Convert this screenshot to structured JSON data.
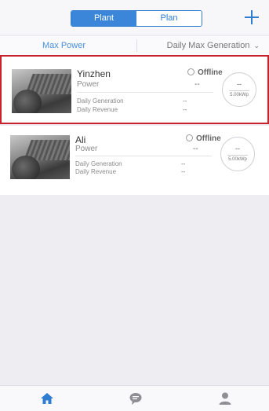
{
  "header": {
    "tabs": [
      {
        "label": "Plant",
        "active": true
      },
      {
        "label": "Plan",
        "active": false
      }
    ],
    "add_icon": "plus-icon"
  },
  "filter": {
    "left_label": "Max Power",
    "right_label": "Daily Max Generation",
    "right_icon": "chevron-down-icon"
  },
  "plants": [
    {
      "name": "Yinzhen",
      "status": "Offline",
      "power_label": "Power",
      "power_value": "--",
      "daily_generation_label": "Daily Generation",
      "daily_generation_value": "--",
      "daily_revenue_label": "Daily Revenue",
      "daily_revenue_value": "--",
      "gauge_value": "--",
      "capacity": "5.00kWp",
      "selected": true
    },
    {
      "name": "Ali",
      "status": "Offline",
      "power_label": "Power",
      "power_value": "--",
      "daily_generation_label": "Daily Generation",
      "daily_generation_value": "--",
      "daily_revenue_label": "Daily Revenue",
      "daily_revenue_value": "--",
      "gauge_value": "--",
      "capacity": "5.00kWp",
      "selected": false
    }
  ],
  "tabbar": {
    "items": [
      {
        "icon": "home-icon",
        "active": true
      },
      {
        "icon": "chat-icon",
        "active": false
      },
      {
        "icon": "user-icon",
        "active": false
      }
    ],
    "active_color": "#2f7dd1",
    "inactive_color": "#8e8e93"
  }
}
